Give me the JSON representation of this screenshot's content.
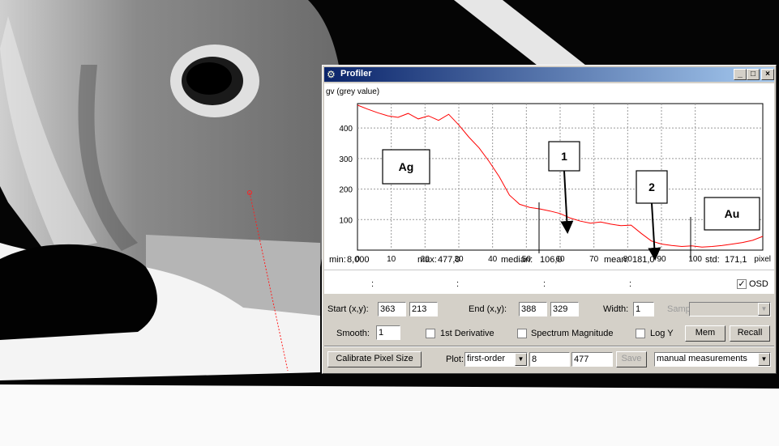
{
  "window": {
    "title": "Profiler",
    "minimize": "_",
    "maximize": "□",
    "close": "×"
  },
  "chart_data": {
    "type": "line",
    "ylabel": "gv (grey value)",
    "xunit": "pixel",
    "xlim": [
      0,
      120
    ],
    "ylim": [
      0,
      480
    ],
    "x_ticks": [
      0,
      10,
      20,
      30,
      40,
      50,
      60,
      70,
      80,
      90,
      100
    ],
    "y_ticks": [
      100,
      200,
      300,
      400
    ],
    "grid": true,
    "series": [
      {
        "color": "#ff0000",
        "x": [
          0,
          3,
          6,
          9,
          12,
          15,
          18,
          21,
          24,
          27,
          30,
          33,
          36,
          39,
          42,
          45,
          48,
          51,
          54,
          57,
          60,
          63,
          66,
          69,
          72,
          75,
          78,
          81,
          84,
          87,
          90,
          93,
          96,
          99,
          102,
          105,
          108,
          111,
          114,
          117,
          120
        ],
        "y": [
          475,
          462,
          450,
          440,
          435,
          448,
          430,
          440,
          425,
          445,
          410,
          370,
          335,
          290,
          240,
          180,
          150,
          140,
          135,
          128,
          120,
          105,
          95,
          88,
          92,
          85,
          80,
          82,
          55,
          30,
          20,
          15,
          12,
          14,
          10,
          12,
          15,
          20,
          25,
          32,
          45
        ]
      }
    ],
    "annotations": [
      {
        "text": "Ag"
      },
      {
        "text": "1"
      },
      {
        "text": "2"
      },
      {
        "text": "Au"
      }
    ]
  },
  "stats": {
    "min_label": "min:",
    "min": "8,000",
    "max_label": "max:",
    "max": "477,0",
    "median_label": "median:",
    "median": "106,0",
    "mean_label": "mean:",
    "mean": "181,0",
    "std_label": "std:",
    "std": "171,1"
  },
  "colons": [
    ":",
    ":",
    ":",
    ":"
  ],
  "osd": {
    "label": "OSD",
    "checked": "✓"
  },
  "controls": {
    "start_label": "Start (x,y):",
    "start_x": "363",
    "start_y": "213",
    "end_label": "End (x,y):",
    "end_x": "388",
    "end_y": "329",
    "width_label": "Width:",
    "width": "1",
    "sampling_label": "Sampling:",
    "sampling": "",
    "smooth_label": "Smooth:",
    "smooth": "1",
    "first_derivative": "1st Derivative",
    "spectrum_magnitude": "Spectrum Magnitude",
    "log_y": "Log Y",
    "mem": "Mem",
    "recall": "Recall",
    "calibrate": "Calibrate Pixel Size",
    "plot_label": "Plot:",
    "plot_type": "first-order",
    "plot_min": "8",
    "plot_max": "477",
    "save": "Save",
    "measure_mode": "manual measurements"
  }
}
